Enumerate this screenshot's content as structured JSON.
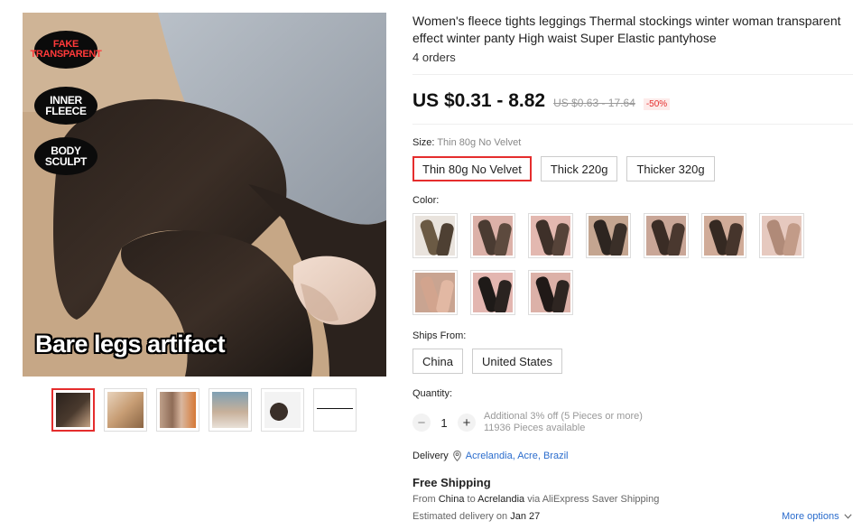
{
  "product": {
    "title": "Women's fleece tights leggings Thermal stockings winter woman transparent effect winter panty High waist Super Elastic pantyhose",
    "orders": "4 orders",
    "price": "US $0.31 - 8.82",
    "old_price": "US $0.63 - 17.64",
    "discount": "-50%"
  },
  "gallery": {
    "badges": [
      "FAKE\nTRANSPARENT",
      "INNER\nFLEECE",
      "BODY\nSCULPT"
    ],
    "caption": "Bare legs artifact",
    "thumbnail_count": 6
  },
  "size": {
    "label": "Size:",
    "selected": "Thin 80g No Velvet",
    "options": [
      "Thin 80g No Velvet",
      "Thick 220g",
      "Thicker 320g"
    ]
  },
  "color": {
    "label": "Color:",
    "swatch_tones": [
      "#6b5a44",
      "#4a3b32",
      "#3e3029",
      "#2d2520",
      "#3a2c25",
      "#352922",
      "#b08a78",
      "#d2a48e",
      "#1e1a18",
      "#201917"
    ]
  },
  "ships_from": {
    "label": "Ships From:",
    "options": [
      "China",
      "United States"
    ]
  },
  "quantity": {
    "label": "Quantity:",
    "minus": "−",
    "plus": "+",
    "value": "1",
    "note_line1": "Additional 3% off (5 Pieces or more)",
    "note_line2": "11936 Pieces available"
  },
  "delivery": {
    "label": "Delivery",
    "location": "Acrelandia, Acre, Brazil",
    "free_shipping": "Free Shipping",
    "from_prefix": "From ",
    "from": "China",
    "to_prefix": " to ",
    "to": "Acrelandia",
    "via": " via AliExpress Saver Shipping",
    "estimated_prefix": "Estimated delivery on ",
    "estimated_date": "Jan 27",
    "more_options": "More options"
  },
  "colors": {
    "accent": "#e52d2d",
    "link": "#2a6ccd"
  }
}
